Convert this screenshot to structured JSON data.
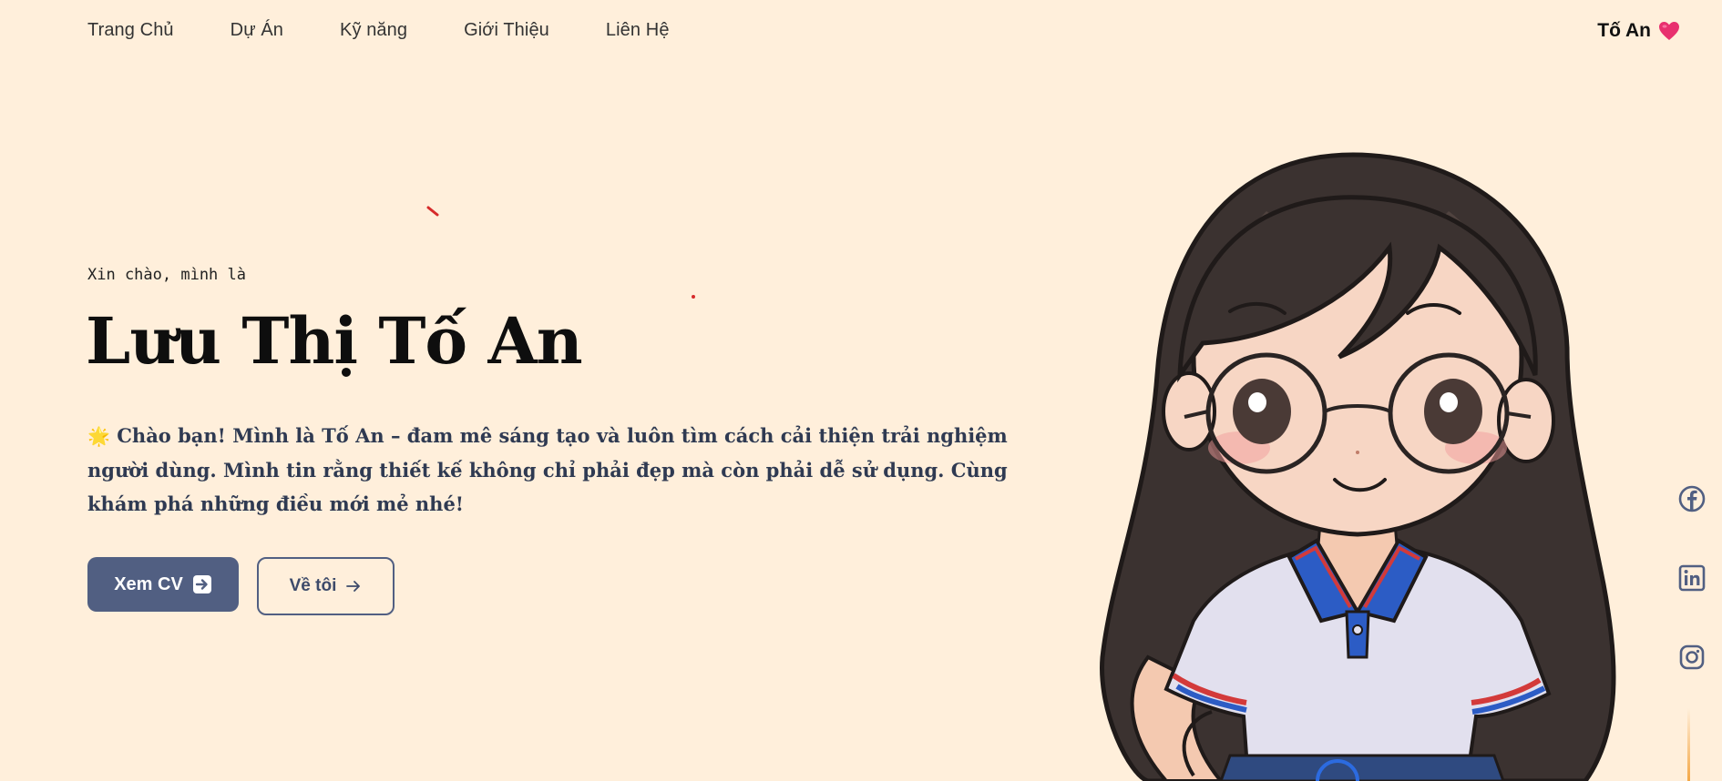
{
  "nav": {
    "items": [
      {
        "label": "Trang Chủ"
      },
      {
        "label": "Dự Án"
      },
      {
        "label": "Kỹ năng"
      },
      {
        "label": "Giới Thiệu"
      },
      {
        "label": "Liên Hệ"
      }
    ]
  },
  "brand": {
    "name": "Tố An",
    "icon": "heart-icon"
  },
  "hero": {
    "greeting": "Xin chào, mình là",
    "name": "Lưu Thị Tố An",
    "sun_icon": "🌟",
    "intro": "Chào bạn! Mình là Tố An – đam mê sáng tạo và luôn tìm cách cải thiện trải nghiệm người dùng. Mình tin rằng thiết kế không chỉ phải đẹp mà còn phải dễ sử dụng. Cùng khám phá những điều mới mẻ nhé!"
  },
  "buttons": {
    "cv_label": "Xem CV",
    "about_label": "Về tôi"
  },
  "social": [
    "facebook-icon",
    "linkedin-icon",
    "instagram-icon"
  ],
  "colors": {
    "background": "#ffefdb",
    "primary": "#515f82",
    "text_dark": "#0e0e0e",
    "heart": "#e8306e"
  }
}
